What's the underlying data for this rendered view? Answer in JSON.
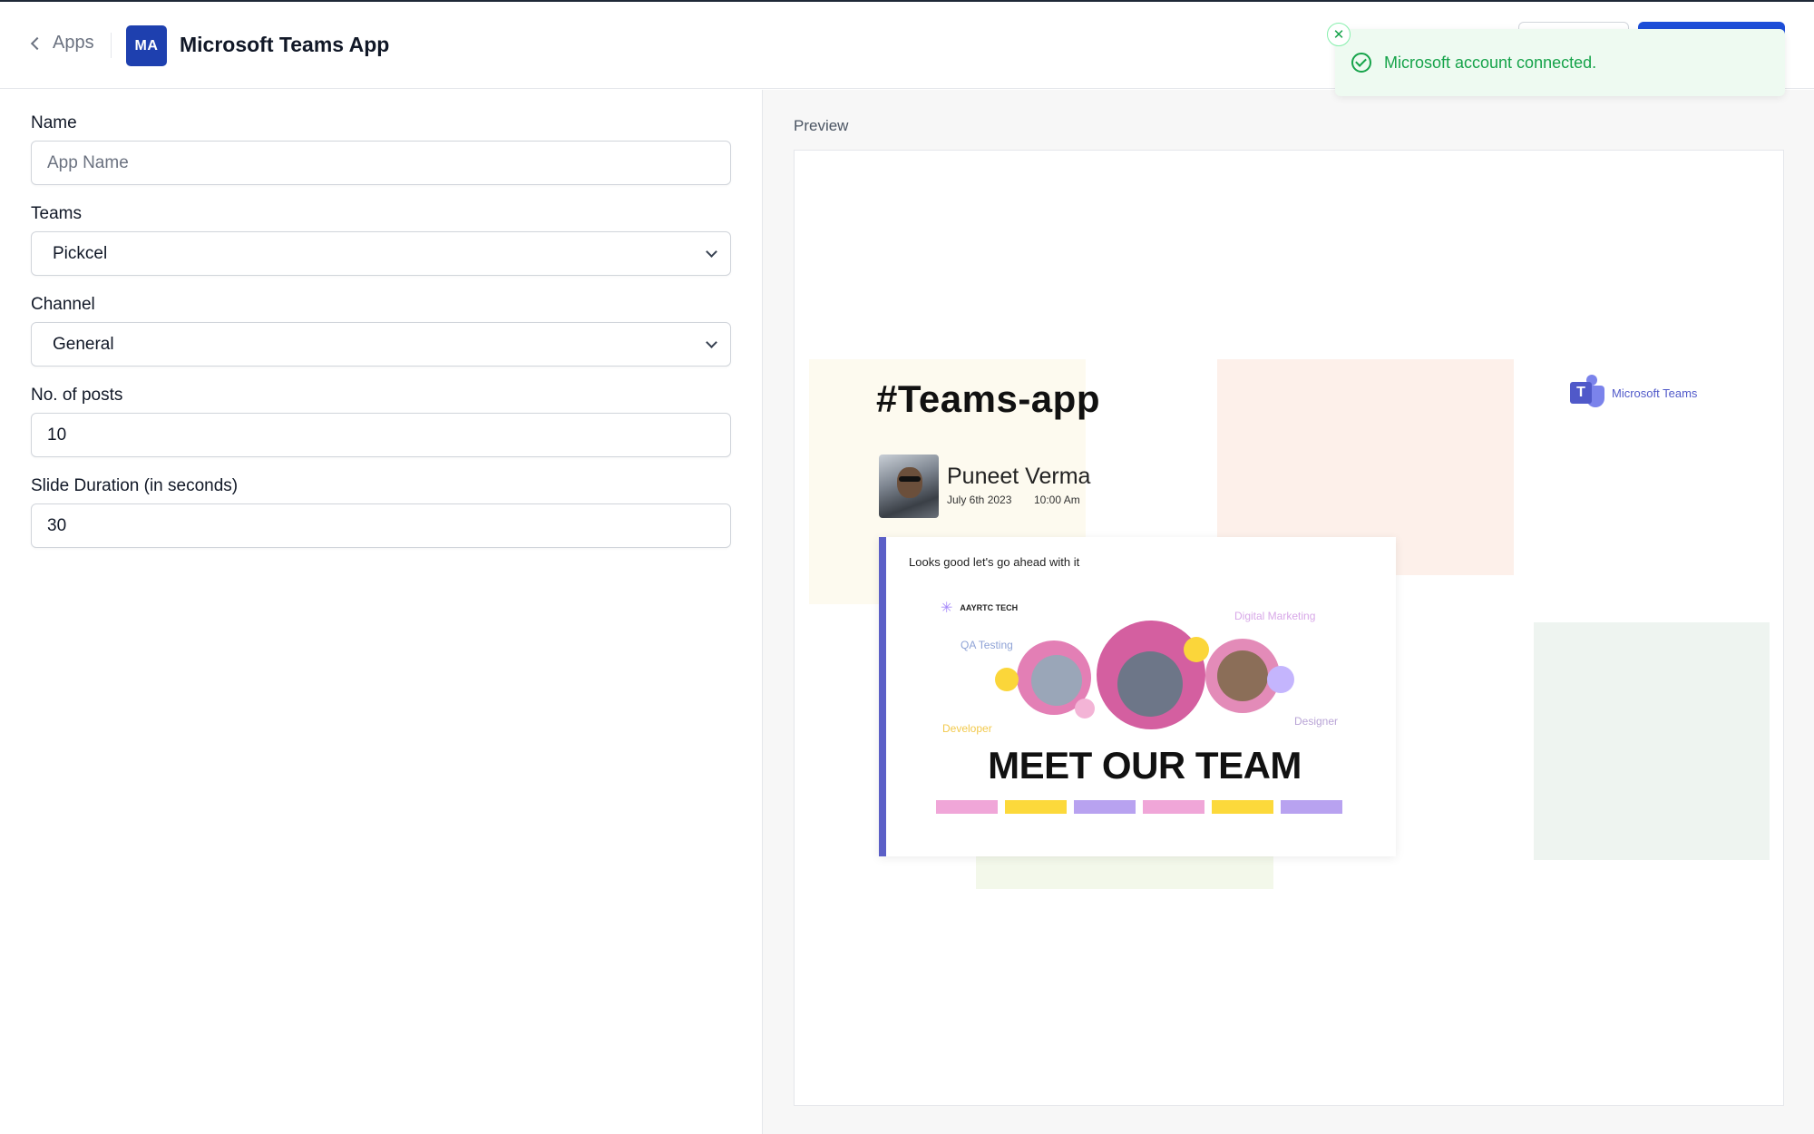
{
  "header": {
    "back_label": "Apps",
    "avatar_initials": "MA",
    "title": "Microsoft Teams App"
  },
  "toast": {
    "message": "Microsoft account connected.",
    "close_icon": "close-icon",
    "status_icon": "check-circle-icon",
    "color": "#16a34a"
  },
  "form": {
    "name": {
      "label": "Name",
      "value": "",
      "placeholder": "App Name"
    },
    "teams": {
      "label": "Teams",
      "value": "Pickcel"
    },
    "channel": {
      "label": "Channel",
      "value": "General"
    },
    "posts": {
      "label": "No. of posts",
      "value": "10"
    },
    "duration": {
      "label": "Slide Duration (in seconds)",
      "value": "30"
    }
  },
  "preview": {
    "label": "Preview",
    "channel_tag": "#Teams-app",
    "user_name": "Puneet Verma",
    "post_date": "July 6th 2023",
    "post_time": "10:00 Am",
    "logo_text": "Microsoft Teams",
    "message": "Looks good let's go ahead with it",
    "brand": "AAYRTC TECH",
    "tags": {
      "qa": "QA Testing",
      "digital": "Digital Marketing",
      "developer": "Developer",
      "designer": "Designer"
    },
    "headline": "MEET OUR TEAM"
  },
  "colors": {
    "accent": "#1d4ed8",
    "avatar_bg": "#1e40af",
    "teams_purple": "#5b5fc7"
  }
}
